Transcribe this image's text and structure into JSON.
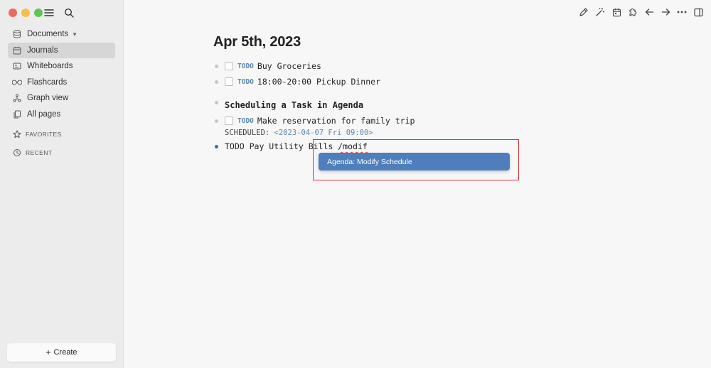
{
  "sidebar": {
    "nav": [
      {
        "label": "Documents",
        "icon": "database-icon"
      },
      {
        "label": "Journals",
        "icon": "calendar-icon"
      },
      {
        "label": "Whiteboards",
        "icon": "whiteboard-icon"
      },
      {
        "label": "Flashcards",
        "icon": "infinity-icon"
      },
      {
        "label": "Graph view",
        "icon": "graph-icon"
      },
      {
        "label": "All pages",
        "icon": "pages-icon"
      }
    ],
    "favorites_label": "FAVORITES",
    "recent_label": "RECENT",
    "create_label": "Create",
    "create_plus": "+"
  },
  "page": {
    "title": "Apr 5th, 2023",
    "todo_tag": "TODO",
    "blocks": [
      {
        "text": "Buy Groceries"
      },
      {
        "text": "18:00-20:00 Pickup Dinner"
      },
      {
        "text": "Scheduling a Task in Agenda"
      },
      {
        "text": "Make reservation for family trip"
      }
    ],
    "scheduled_label": "SCHEDULED:",
    "scheduled_date": "<2023-04-07 Fri 09:00>",
    "editing_text": "TODO Pay Utility Bills ",
    "editing_typed": "/modif"
  },
  "popup": {
    "item_label": "Agenda: Modify Schedule"
  },
  "colors": {
    "accent": "#4e7fbc",
    "todo": "#5b87b3",
    "highlight_border": "#d8303c"
  }
}
